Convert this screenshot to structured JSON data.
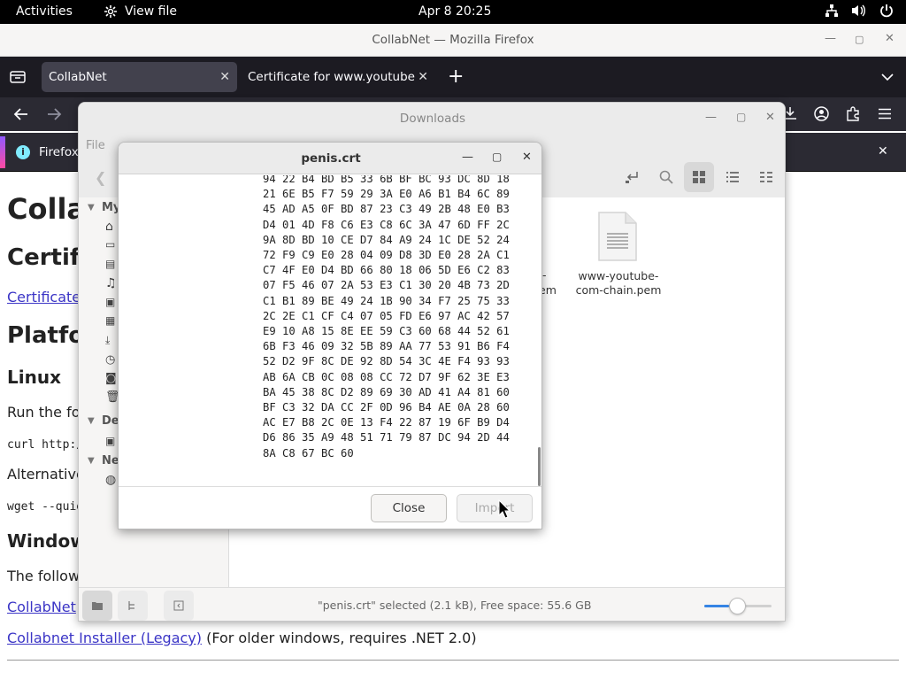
{
  "topbar": {
    "activities": "Activities",
    "app_name": "View file",
    "clock": "Apr 8  20:25"
  },
  "firefox": {
    "window_title": "CollabNet — Mozilla Firefox",
    "tabs": [
      {
        "label": "CollabNet",
        "active": true
      },
      {
        "label": "Certificate for www.youtube.co",
        "active": false
      }
    ],
    "infobar_text": "Firefox"
  },
  "webpage": {
    "h1": "Colla",
    "h2_cert": "Certifi",
    "cert_link": "Certificate",
    "h2_platform": "Platfo",
    "h3_linux": "Linux",
    "run_text": "Run the fo",
    "curl_cmd": "curl http:/",
    "alt_text": "Alternative",
    "wget_cmd": "wget --quie",
    "h3_windows": "Window",
    "follow_text": "The follow",
    "collabnet_link": "CollabNet",
    "legacy_link": "Collabnet Installer (Legacy)",
    "legacy_note": " (For older windows, requires .NET 2.0)"
  },
  "downloads": {
    "title": "Downloads",
    "menu_file": "File",
    "sidebar": {
      "my_label": "My",
      "devices_label": "De",
      "network_label": "Ne"
    },
    "files": [
      {
        "name": "www-youtube-com-chain.pem",
        "name_line1": "www-youtube-",
        "name_line2": "com-chain.pem"
      }
    ],
    "partial_file_label_1": "-",
    "partial_file_label_2": "em",
    "status": "\"penis.crt\" selected (2.1 kB), Free space: 55.6 GB",
    "zoom_level": 0.5
  },
  "cert_dialog": {
    "title": "penis.crt",
    "hex_lines": [
      "94 22 B4 BD B5 33 6B BF BC 93 DC 8D 18",
      "21 6E B5 F7 59 29 3A E0 A6 B1 B4 6C 89",
      "45 AD A5 0F BD 87 23 C3 49 2B 48 E0 B3",
      "D4 01 4D F8 C6 E3 C8 6C 3A 47 6D FF 2C",
      "9A 8D BD 10 CE D7 84 A9 24 1C DE 52 24",
      "72 F9 C9 E0 28 04 09 D8 3D E0 28 2A C1",
      "C7 4F E0 D4 BD 66 80 18 06 5D E6 C2 83",
      "07 F5 46 07 2A 53 E3 C1 30 20 4B 73 2D",
      "C1 B1 89 BE 49 24 1B 90 34 F7 25 75 33",
      "2C 2E C1 CF C4 07 05 FD E6 97 AC 42 57",
      "E9 10 A8 15 8E EE 59 C3 60 68 44 52 61",
      "6B F3 46 09 32 5B 89 AA 77 53 91 B6 F4",
      "52 D2 9F 8C DE 92 8D 54 3C 4E F4 93 93",
      "AB 6A CB 0C 08 08 CC 72 D7 9F 62 3E E3",
      "BA 45 38 8C D2 89 69 30 AD 41 A4 81 60",
      "BF C3 32 DA CC 2F 0D 96 B4 AE 0A 28 60",
      "AC E7 B8 2C 0E 13 F4 22 87 19 6F B9 D4",
      "D6 86 35 A9 48 51 71 79 87 DC 94 2D 44",
      "8A C8 67 BC 60"
    ],
    "close_label": "Close",
    "import_label": "Import"
  }
}
